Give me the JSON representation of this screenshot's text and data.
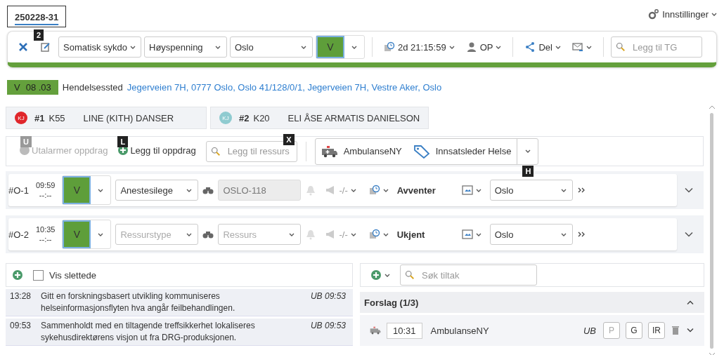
{
  "case_tab": {
    "label": "250228-31",
    "selected": true,
    "keytip": "2"
  },
  "settings": {
    "label": "Innstillinger"
  },
  "toolbar": {
    "selects": [
      "Somatisk sykdo",
      "Høyspenning",
      "Oslo"
    ],
    "priority": "V",
    "timer": "2d 21:15:59",
    "role": "OP",
    "share": "Del",
    "search_placeholder": "Legg til TG"
  },
  "incident": {
    "priority": "V",
    "time": "08 .03",
    "label": "Hendelsessted",
    "address": "Jegerveien 7H, 0777 Oslo, Oslo 41/128/0/1, Jegerveien 7H, Vestre Aker, Oslo"
  },
  "patients": [
    {
      "initials": "KJ",
      "color": "#e0262b",
      "number": "#1",
      "code": "K55",
      "name": "LINE (KITH) DANSER"
    },
    {
      "initials": "KJ",
      "color": "#8fcbd0",
      "number": "#2",
      "code": "K20",
      "name": "ELI ÅSE ARMATIS DANIELSON"
    }
  ],
  "actions": {
    "unalarm": {
      "label": "Utalarmer oppdrag",
      "disabled": true,
      "keytip": "U"
    },
    "add": {
      "label": "Legg til oppdrag",
      "keytip": "L"
    },
    "resource_search": {
      "placeholder": "Legg til ressurs",
      "keytip": "X"
    },
    "more_keytip": "H",
    "resources": [
      {
        "kind": "ambulance",
        "label": "AmbulanseNY"
      },
      {
        "kind": "tag",
        "label": "Innsatsleder Helse"
      }
    ]
  },
  "orders": [
    {
      "id": "#O-1",
      "time": "09:59",
      "time2": "--:--",
      "priority": "V",
      "type": {
        "value": "Anestesilege"
      },
      "resource": {
        "value": "OSLO-118",
        "disabled": true
      },
      "ratio": "-/-",
      "status": "Avventer",
      "region": "Oslo"
    },
    {
      "id": "#O-2",
      "time": "10:35",
      "time2": "--:--",
      "priority": "V",
      "type": {
        "placeholder": "Ressurstype"
      },
      "resource": {
        "placeholder": "Ressurs",
        "disabled": false
      },
      "ratio": "-/-",
      "status": "Ukjent",
      "region": "Oslo"
    }
  ],
  "log": {
    "show_deleted": {
      "label": "Vis slettede",
      "checked": false
    },
    "entries": [
      {
        "time": "13:28",
        "text": "Gitt en forskningsbasert utvikling kommuniseres helseinformasjonsflyten hva angår feilbehandlingen.",
        "author": "UB 09:53"
      },
      {
        "time": "09:53",
        "text": "Sammenholdt med en tiltagende treffsikkerhet lokaliseres sykehusdirektørens visjon ut fra DRG-produksjonen.",
        "author": "UB 09:53"
      }
    ]
  },
  "measures": {
    "search_placeholder": "Søk tiltak",
    "group": {
      "title": "Forslag (1/3)",
      "expanded": true,
      "items": [
        {
          "time": "10:31",
          "name": "AmbulanseNY",
          "author": "UB",
          "flags": [
            {
              "label": "P",
              "disabled": true
            },
            {
              "label": "G",
              "disabled": false
            },
            {
              "label": "IR",
              "disabled": false
            }
          ]
        }
      ]
    }
  }
}
